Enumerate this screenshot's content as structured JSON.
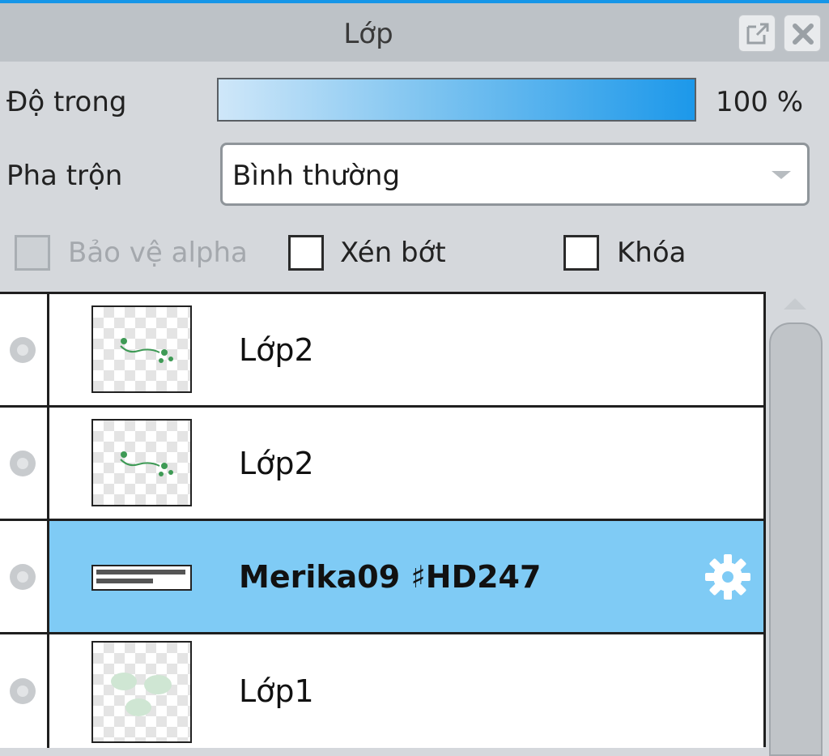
{
  "panel": {
    "title": "Lớp"
  },
  "window_buttons": {
    "float_icon": "float-window-icon",
    "close_icon": "close-icon"
  },
  "opacity": {
    "label": "Độ trong",
    "value_text": "100 %",
    "value": 100
  },
  "blend": {
    "label": "Pha trộn",
    "value": "Bình thường"
  },
  "options": [
    {
      "label": "Bảo vệ alpha",
      "checked": false,
      "disabled": true
    },
    {
      "label": "Xén bớt",
      "checked": false,
      "disabled": false
    },
    {
      "label": "Khóa",
      "checked": false,
      "disabled": false
    }
  ],
  "layers": [
    {
      "name": "Lớp2",
      "thumb": "green-sketch",
      "selected": false
    },
    {
      "name": "Lớp2",
      "thumb": "green-sketch",
      "selected": false
    },
    {
      "name": "Merika09 ♯HD247",
      "thumb": "text-strip",
      "selected": true,
      "icon": "gear-icon"
    },
    {
      "name": "Lớp1",
      "thumb": "pale-green-blobs",
      "selected": false
    }
  ],
  "colors": {
    "accent": "#1696e8",
    "selected_row": "#7fcbf5"
  }
}
